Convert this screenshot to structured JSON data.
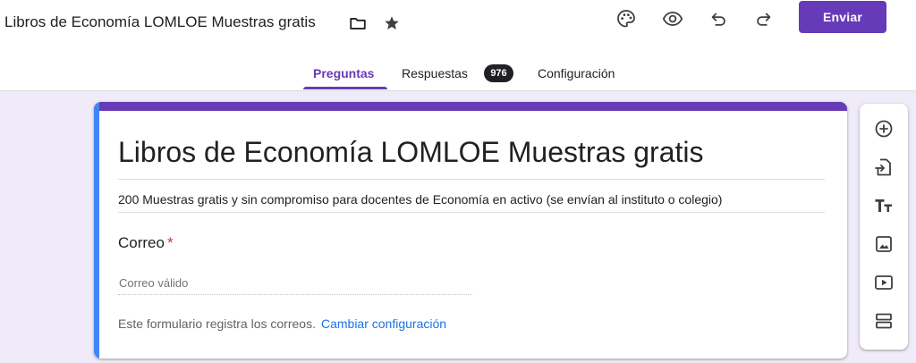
{
  "header": {
    "title": "Libros de Economía LOMLOE Muestras gratis",
    "send_label": "Enviar",
    "icons": [
      "folder-icon",
      "star-icon",
      "palette-icon",
      "preview-eye-icon",
      "undo-icon",
      "redo-icon"
    ]
  },
  "tabs": {
    "questions": "Preguntas",
    "responses": "Respuestas",
    "responses_count": "976",
    "settings": "Configuración"
  },
  "form": {
    "title": "Libros de Economía LOMLOE Muestras gratis",
    "description": "200 Muestras gratis y sin compromiso para docentes de Economía en activo (se envían al instituto o colegio)",
    "email_label": "Correo",
    "required_mark": "*",
    "email_placeholder": "Correo válido",
    "notice_text": "Este formulario registra los correos.",
    "notice_link": "Cambiar configuración"
  },
  "toolbar": {
    "items": [
      "add-question-icon",
      "import-questions-icon",
      "add-title-icon",
      "add-image-icon",
      "add-video-icon",
      "add-section-icon"
    ]
  },
  "colors": {
    "accent": "#673ab7",
    "background": "#f0ebf8",
    "link": "#1a73e8",
    "required": "#d93025",
    "card_left_bar": "#4285f4"
  }
}
